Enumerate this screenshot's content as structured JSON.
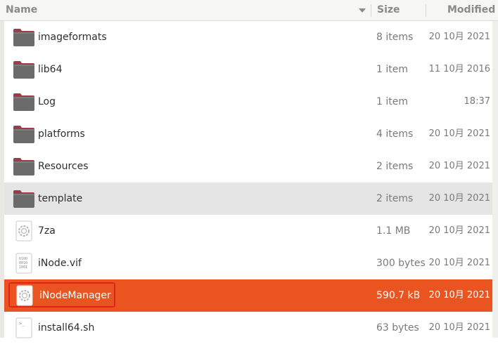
{
  "header": {
    "name_label": "Name",
    "size_label": "Size",
    "modified_label": "Modified"
  },
  "files": [
    {
      "name": "imageformats",
      "size": "8 items",
      "modified": "20 10月 2021",
      "icon": "folder-icon"
    },
    {
      "name": "lib64",
      "size": "1 item",
      "modified": "11 10月 2016",
      "icon": "folder-icon"
    },
    {
      "name": "Log",
      "size": "1 item",
      "modified": "18:37",
      "icon": "folder-icon"
    },
    {
      "name": "platforms",
      "size": "4 items",
      "modified": "20 10月 2021",
      "icon": "folder-icon"
    },
    {
      "name": "Resources",
      "size": "2 items",
      "modified": "20 10月 2021",
      "icon": "folder-icon"
    },
    {
      "name": "template",
      "size": "2 items",
      "modified": "20 10月 2021",
      "icon": "folder-icon",
      "state": "hover"
    },
    {
      "name": "7za",
      "size": "1.1 MB",
      "modified": "20 10月 2021",
      "icon": "executable-gear-icon"
    },
    {
      "name": "iNode.vif",
      "size": "300 bytes",
      "modified": "20 10月 2021",
      "icon": "binary-file-icon"
    },
    {
      "name": "iNodeManager",
      "size": "590.7 kB",
      "modified": "20 10月 2021",
      "icon": "executable-gear-icon",
      "state": "selected"
    },
    {
      "name": "install64.sh",
      "size": "63 bytes",
      "modified": "20 10月 2021",
      "icon": "shell-script-icon"
    }
  ],
  "colors": {
    "selection": "#e95420",
    "hover": "#e5e5e5",
    "folder_body": "#6b6b6b",
    "folder_tab": "#9e3a4a",
    "highlight_box": "#e2221b"
  }
}
